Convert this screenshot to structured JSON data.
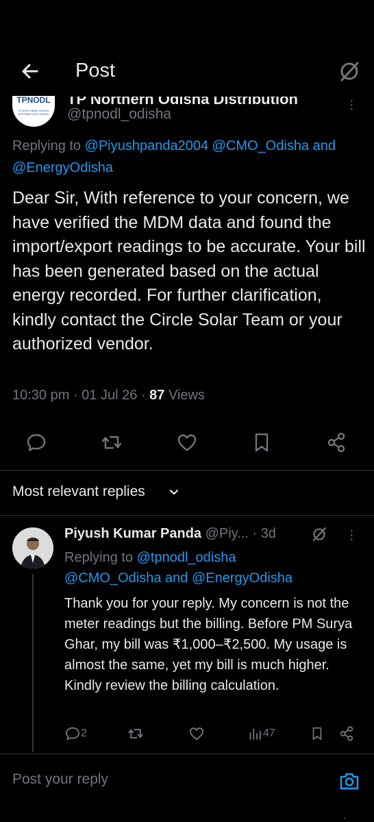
{
  "header": {
    "title": "Post"
  },
  "post": {
    "author_name": "TP Northern Odisha Distribution",
    "handle": "@tpnodl_odisha",
    "avatar_logo": "TPNODL",
    "avatar_sub": "TP NORTHERN ODISHA DISTRIBUTION LIMITED",
    "replying_label": "Replying to",
    "replying_to_1": "@Piyushpanda2004",
    "replying_to_2": "@CMO_Odisha",
    "replying_and": "and",
    "replying_to_3": "@EnergyOdisha",
    "body": "Dear Sir, With reference to your concern, we have verified the MDM data and found the import/export readings to be accurate. Your bill has been generated based on the actual energy recorded. For further clarification, kindly contact the Circle Solar Team or your authorized vendor.",
    "time": "10:30 pm",
    "date": "01 Jul 26",
    "views_count": "87",
    "views_label": "Views"
  },
  "replies_sort": {
    "label": "Most relevant replies"
  },
  "reply": {
    "author_name": "Piyush Kumar Panda",
    "handle": "@Piy...",
    "time_ago": "3d",
    "replying_label": "Replying to",
    "replying_to_1": "@tpnodl_odisha",
    "replying_to_2": "@CMO_Odisha",
    "replying_and": "and",
    "replying_to_3": "@EnergyOdisha",
    "body": "Thank you for your reply. My concern is not the meter readings but the billing. Before PM Surya Ghar, my bill was ₹1,000–₹2,500. My usage is almost the same, yet my bill is much higher. Kindly review the billing calculation.",
    "reply_count": "2",
    "views_count": "47"
  },
  "compose": {
    "placeholder": "Post your reply"
  },
  "colors": {
    "accent": "#1d9bf0",
    "muted": "#71767b",
    "text": "#e7e9ea",
    "background": "#000000",
    "divider": "#2f3336"
  }
}
